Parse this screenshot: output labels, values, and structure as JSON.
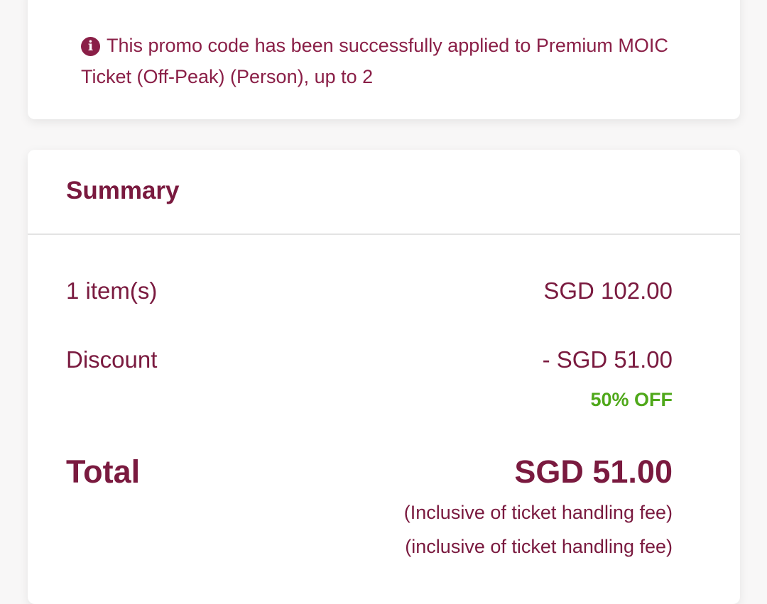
{
  "promo": {
    "icon": "info-icon",
    "message": "This promo code has been successfully applied to Premium MOIC Ticket (Off-Peak) (Person), up to 2"
  },
  "summary": {
    "title": "Summary",
    "items_label": "1 item(s)",
    "items_value": "SGD 102.00",
    "discount_label": "Discount",
    "discount_value": "- SGD 51.00",
    "discount_badge": "50% OFF",
    "total_label": "Total",
    "total_value": "SGD 51.00",
    "note_1": "(Inclusive of ticket handling fee)",
    "note_2": "(inclusive of ticket handling fee)"
  },
  "colors": {
    "brand": "#7a1a3f",
    "discount_green": "#4fa81a",
    "background": "#f8f7f7",
    "card": "#ffffff"
  }
}
